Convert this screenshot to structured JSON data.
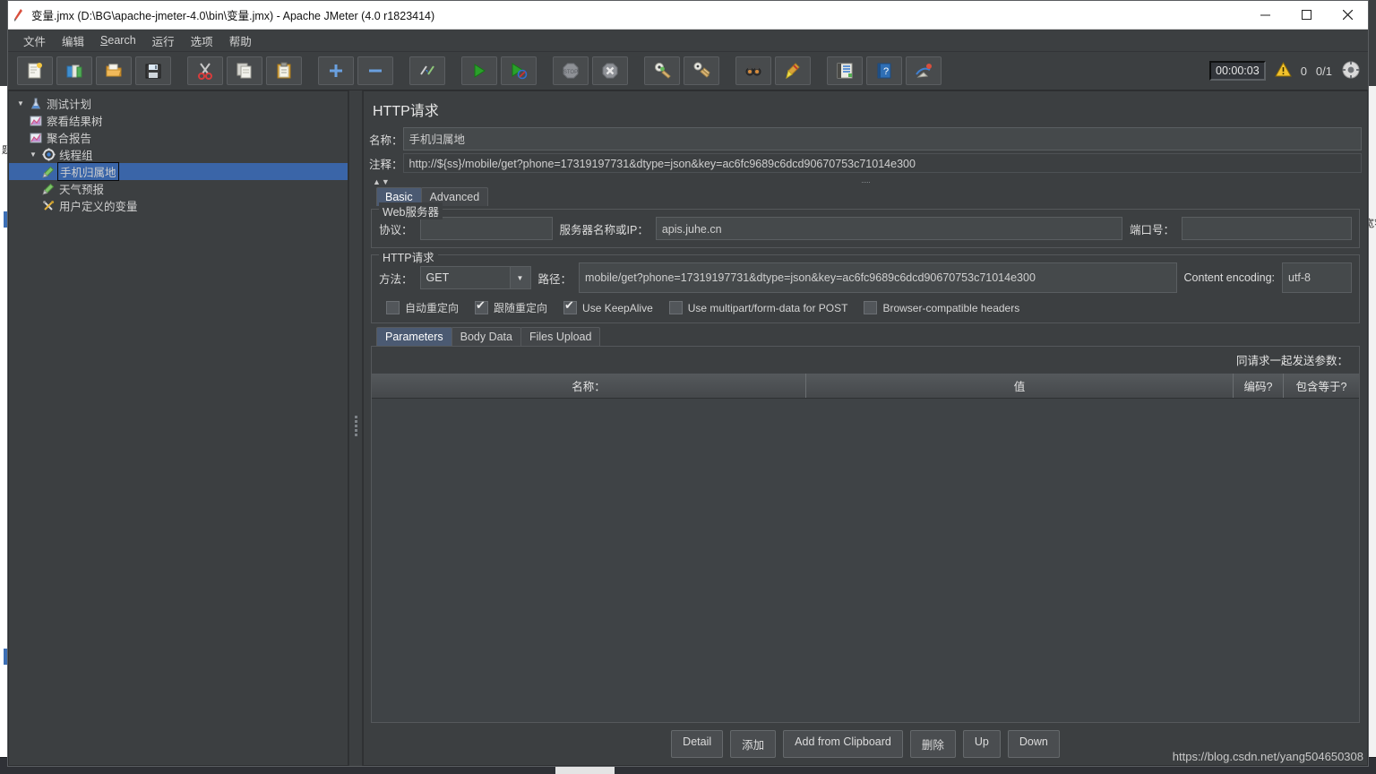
{
  "window": {
    "title": "变量.jmx (D:\\BG\\apache-jmeter-4.0\\bin\\变量.jmx) - Apache JMeter (4.0 r1823414)",
    "app_icon": "jmeter-feather-icon",
    "minimize_label": "—",
    "maximize_label": "▢",
    "close_label": "✕"
  },
  "menubar": {
    "items": [
      {
        "label": "文件",
        "name": "menu-file"
      },
      {
        "label": "编辑",
        "name": "menu-edit"
      },
      {
        "label": "Search",
        "name": "menu-search",
        "mnemonic": "S"
      },
      {
        "label": "运行",
        "name": "menu-run"
      },
      {
        "label": "选项",
        "name": "menu-options"
      },
      {
        "label": "帮助",
        "name": "menu-help"
      }
    ]
  },
  "toolbar": {
    "buttons": [
      {
        "icon": "new-document-icon",
        "name": "toolbar-new",
        "tooltip": "新建"
      },
      {
        "icon": "templates-icon",
        "name": "toolbar-templates",
        "tooltip": "模板"
      },
      {
        "icon": "open-folder-icon",
        "name": "toolbar-open",
        "tooltip": "打开"
      },
      {
        "icon": "save-floppy-icon",
        "name": "toolbar-save",
        "tooltip": "保存"
      },
      {
        "icon": "cut-scissors-icon",
        "name": "toolbar-cut",
        "tooltip": "剪切",
        "group_gap": true
      },
      {
        "icon": "copy-icon",
        "name": "toolbar-copy",
        "tooltip": "复制"
      },
      {
        "icon": "paste-clipboard-icon",
        "name": "toolbar-paste",
        "tooltip": "粘贴"
      },
      {
        "icon": "plus-icon",
        "name": "toolbar-expand-all",
        "tooltip": "展开全部",
        "group_gap": true
      },
      {
        "icon": "minus-icon",
        "name": "toolbar-collapse-all",
        "tooltip": "收起全部"
      },
      {
        "icon": "toggle-icon",
        "name": "toolbar-toggle",
        "tooltip": "启用/禁用",
        "group_gap": true
      },
      {
        "icon": "start-play-icon",
        "name": "toolbar-start",
        "tooltip": "启动",
        "group_gap": true
      },
      {
        "icon": "start-no-pause-icon",
        "name": "toolbar-start-no-pauses",
        "tooltip": "无暂停启动"
      },
      {
        "icon": "stop-icon",
        "name": "toolbar-stop",
        "tooltip": "停止",
        "group_gap": true
      },
      {
        "icon": "shutdown-icon",
        "name": "toolbar-shutdown",
        "tooltip": "关闭"
      },
      {
        "icon": "clear-icon",
        "name": "toolbar-clear",
        "tooltip": "清除",
        "group_gap": true
      },
      {
        "icon": "clear-all-icon",
        "name": "toolbar-clear-all",
        "tooltip": "清除全部"
      },
      {
        "icon": "search-binoculars-icon",
        "name": "toolbar-search",
        "tooltip": "搜索",
        "group_gap": true
      },
      {
        "icon": "reset-search-broom-icon",
        "name": "toolbar-reset-search",
        "tooltip": "重置搜索"
      },
      {
        "icon": "function-helper-icon",
        "name": "toolbar-function-helper",
        "tooltip": "函数助手",
        "group_gap": true
      },
      {
        "icon": "help-book-icon",
        "name": "toolbar-help",
        "tooltip": "帮助"
      },
      {
        "icon": "undo-redo-icon",
        "name": "toolbar-extra",
        "tooltip": "更多"
      }
    ],
    "status": {
      "elapsed": "00:00:03",
      "warning_icon": "warning-triangle-icon",
      "warning_count": "0",
      "threads": "0/1",
      "gear_icon": "thread-gear-icon"
    }
  },
  "tree": {
    "nodes": [
      {
        "label": "测试计划",
        "icon": "test-plan-icon",
        "arrow": "▼",
        "depth": 0,
        "selected": false,
        "name": "tree-node-test-plan"
      },
      {
        "label": "察看结果树",
        "icon": "view-results-tree-icon",
        "arrow": "",
        "depth": 1,
        "selected": false,
        "name": "tree-node-view-results-tree"
      },
      {
        "label": "聚合报告",
        "icon": "aggregate-report-icon",
        "arrow": "",
        "depth": 1,
        "selected": false,
        "name": "tree-node-aggregate-report"
      },
      {
        "label": "线程组",
        "icon": "thread-group-icon",
        "arrow": "▼",
        "depth": 1,
        "selected": false,
        "name": "tree-node-thread-group"
      },
      {
        "label": "手机归属地",
        "icon": "http-sampler-icon",
        "arrow": "",
        "depth": 2,
        "selected": true,
        "name": "tree-node-phone-location"
      },
      {
        "label": "天气预报",
        "icon": "http-sampler-icon",
        "arrow": "",
        "depth": 2,
        "selected": false,
        "name": "tree-node-weather-forecast"
      },
      {
        "label": "用户定义的变量",
        "icon": "user-defined-variables-icon",
        "arrow": "",
        "depth": 2,
        "selected": false,
        "name": "tree-node-user-defined-variables"
      }
    ]
  },
  "editor": {
    "panel_title": "HTTP请求",
    "name_label": "名称：",
    "name_value": "手机归属地",
    "comment_label": "注释：",
    "comment_value": "http://${ss}/mobile/get?phone=17319197731&dtype=json&key=ac6fc9689c6dcd90670753c71014e300",
    "collapse_caret": "▲▼",
    "resize_dots": "·····",
    "main_tabs": [
      {
        "label": "Basic",
        "active": true,
        "name": "tab-basic"
      },
      {
        "label": "Advanced",
        "active": false,
        "name": "tab-advanced"
      }
    ],
    "web_server": {
      "legend": "Web服务器",
      "protocol_label": "协议：",
      "protocol_value": "",
      "server_label": "服务器名称或IP：",
      "server_value": "apis.juhe.cn",
      "port_label": "端口号：",
      "port_value": ""
    },
    "http_request": {
      "legend": "HTTP请求",
      "method_label": "方法：",
      "method_value": "GET",
      "method_arrow": "▼",
      "path_label": "路径：",
      "path_value": "mobile/get?phone=17319197731&dtype=json&key=ac6fc9689c6dcd90670753c71014e300",
      "content_encoding_label": "Content encoding:",
      "content_encoding_value": "utf-8",
      "checkboxes": [
        {
          "label": "自动重定向",
          "checked": false,
          "name": "checkbox-auto-redirect"
        },
        {
          "label": "跟随重定向",
          "checked": true,
          "name": "checkbox-follow-redirect"
        },
        {
          "label": "Use KeepAlive",
          "checked": true,
          "name": "checkbox-use-keepalive"
        },
        {
          "label": "Use multipart/form-data for POST",
          "checked": false,
          "name": "checkbox-use-multipart"
        },
        {
          "label": "Browser-compatible headers",
          "checked": false,
          "name": "checkbox-browser-compatible-headers"
        }
      ]
    },
    "param_tabs": [
      {
        "label": "Parameters",
        "active": true,
        "name": "tab-parameters"
      },
      {
        "label": "Body Data",
        "active": false,
        "name": "tab-body-data"
      },
      {
        "label": "Files Upload",
        "active": false,
        "name": "tab-files-upload"
      }
    ],
    "params_table": {
      "caption": "同请求一起发送参数：",
      "columns": [
        "名称：",
        "值",
        "编码?",
        "包含等于?"
      ],
      "rows": []
    },
    "action_buttons": [
      {
        "label": "Detail",
        "name": "button-detail"
      },
      {
        "label": "添加",
        "name": "button-add"
      },
      {
        "label": "Add from Clipboard",
        "name": "button-add-from-clipboard"
      },
      {
        "label": "删除",
        "name": "button-delete"
      },
      {
        "label": "Up",
        "name": "button-up"
      },
      {
        "label": "Down",
        "name": "button-down"
      }
    ]
  },
  "watermark": "https://blog.csdn.net/yang504650308",
  "background": {
    "left_sliver_text": "题",
    "right_sliver_text": "长宽窄"
  },
  "colors": {
    "window_bg": "#3c3f41",
    "accent_selection": "#3a65a8",
    "tab_active": "#4b5a72",
    "text_primary": "#dcdcdc",
    "field_bg": "#45494b"
  }
}
